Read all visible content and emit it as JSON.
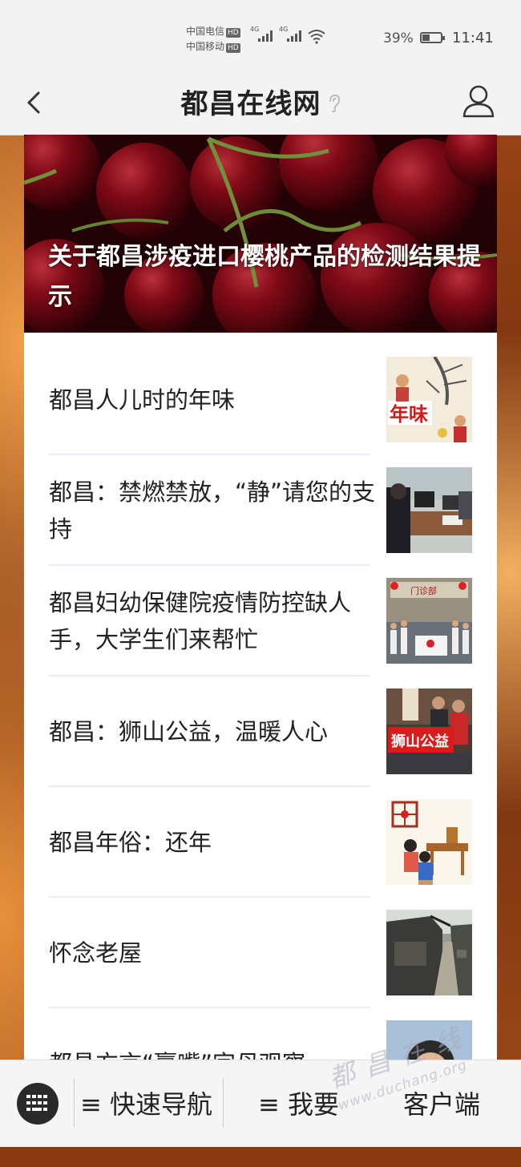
{
  "status_bar": {
    "carrier_1": "中国电信",
    "carrier_2": "中国移动",
    "hd": "HD",
    "net_1": "4G",
    "net_2": "4G",
    "battery_percent": "39%",
    "battery_level": 0.39,
    "time": "11:41"
  },
  "header": {
    "title": "都昌在线网",
    "ear_icon": "ear-icon",
    "back_icon": "chevron-left-icon",
    "user_icon": "user-icon"
  },
  "hero": {
    "title": "关于都昌涉疫进口樱桃产品的检测结果提示",
    "image": "cherries-photo"
  },
  "articles": [
    {
      "title": "都昌人儿时的年味",
      "thumb": "new-year-illustration",
      "thumb_text": "年味"
    },
    {
      "title": "都昌：禁燃禁放，“静”请您的支持",
      "thumb": "office-photo"
    },
    {
      "title": "都昌妇幼保健院疫情防控缺人手，大学生们来帮忙",
      "thumb": "volunteers-photo",
      "thumb_text": "门诊部"
    },
    {
      "title": "都昌：狮山公益，温暖人心",
      "thumb": "charity-photo",
      "thumb_text": "狮山公益"
    },
    {
      "title": "都昌年俗：还年",
      "thumb": "family-illustration"
    },
    {
      "title": "怀念老屋",
      "thumb": "old-house-photo"
    },
    {
      "title": "都昌方言“赢嘴”字母观察",
      "thumb": "portrait-photo"
    }
  ],
  "bottom_bar": {
    "keyboard_icon": "keyboard-icon",
    "quick_nav": "≡ 快速导航",
    "want": "≡ 我要",
    "client": "客户端"
  },
  "watermark": {
    "line1": "都昌在线",
    "line2": "www.duchang.org"
  }
}
